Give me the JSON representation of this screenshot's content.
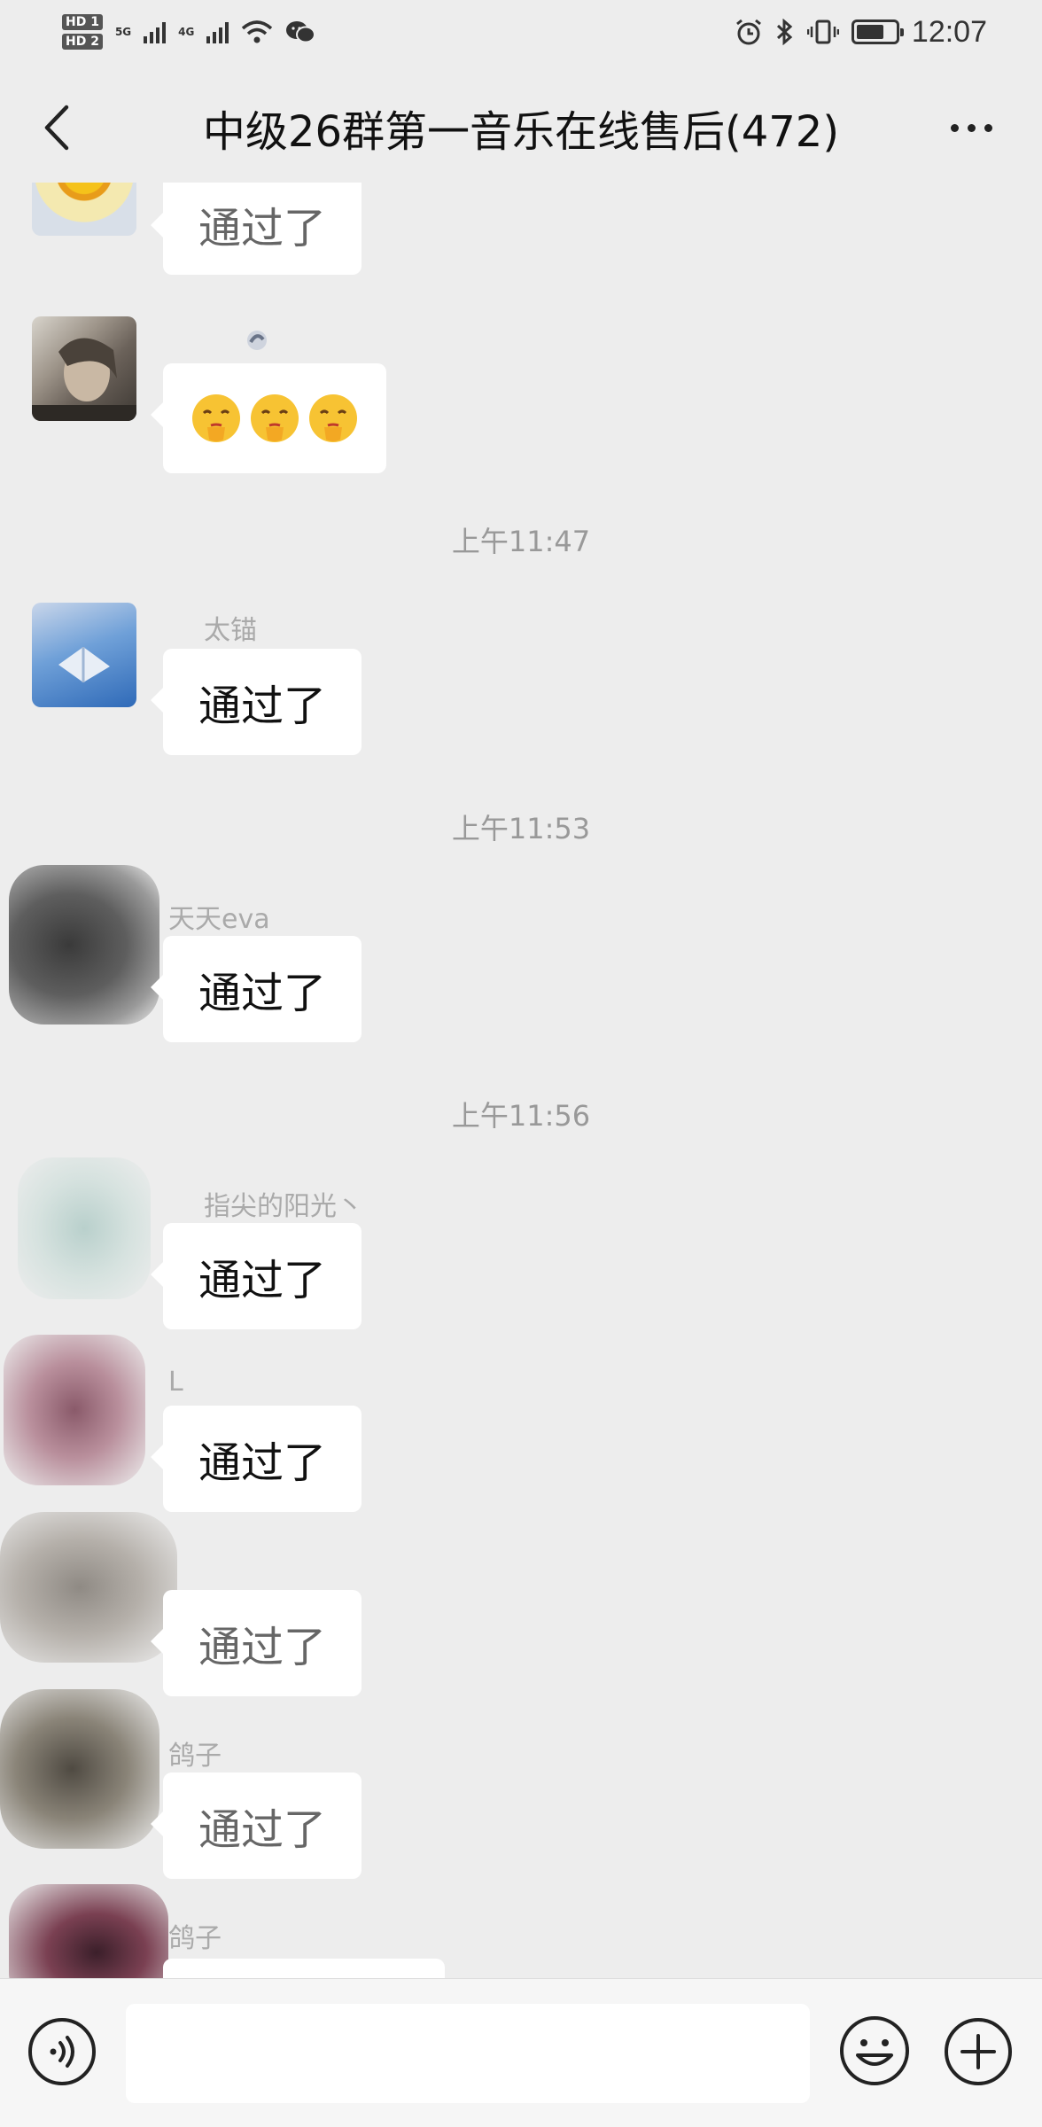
{
  "status_bar": {
    "hd1": "HD 1",
    "hd2": "HD 2",
    "net1": "5G",
    "net2": "4G",
    "time": "12:07"
  },
  "header": {
    "title": "中级26群第一音乐在线售后(472)"
  },
  "messages": [
    {
      "sender": "",
      "text": "通过了",
      "faded": true
    },
    {
      "sender": "",
      "text": "",
      "emoji": [
        "shushing-face-icon",
        "shushing-face-icon",
        "shushing-face-icon"
      ]
    },
    {
      "time": "上午11:47"
    },
    {
      "sender": "太锚",
      "text": "通过了"
    },
    {
      "time": "上午11:53"
    },
    {
      "sender": "天天eva",
      "text": "通过了"
    },
    {
      "time": "上午11:56"
    },
    {
      "sender": "指尖的阳光丶",
      "text": "通过了"
    },
    {
      "sender": "L",
      "text": "通过了"
    },
    {
      "sender": "",
      "text": "通过了"
    },
    {
      "sender": "鸽子",
      "text": "通过了"
    },
    {
      "sender": "鸽子",
      "text": ""
    }
  ],
  "input": {
    "placeholder": ""
  },
  "colors": {
    "background": "#ededed",
    "bubble": "#ffffff",
    "timestamp": "#999999"
  }
}
